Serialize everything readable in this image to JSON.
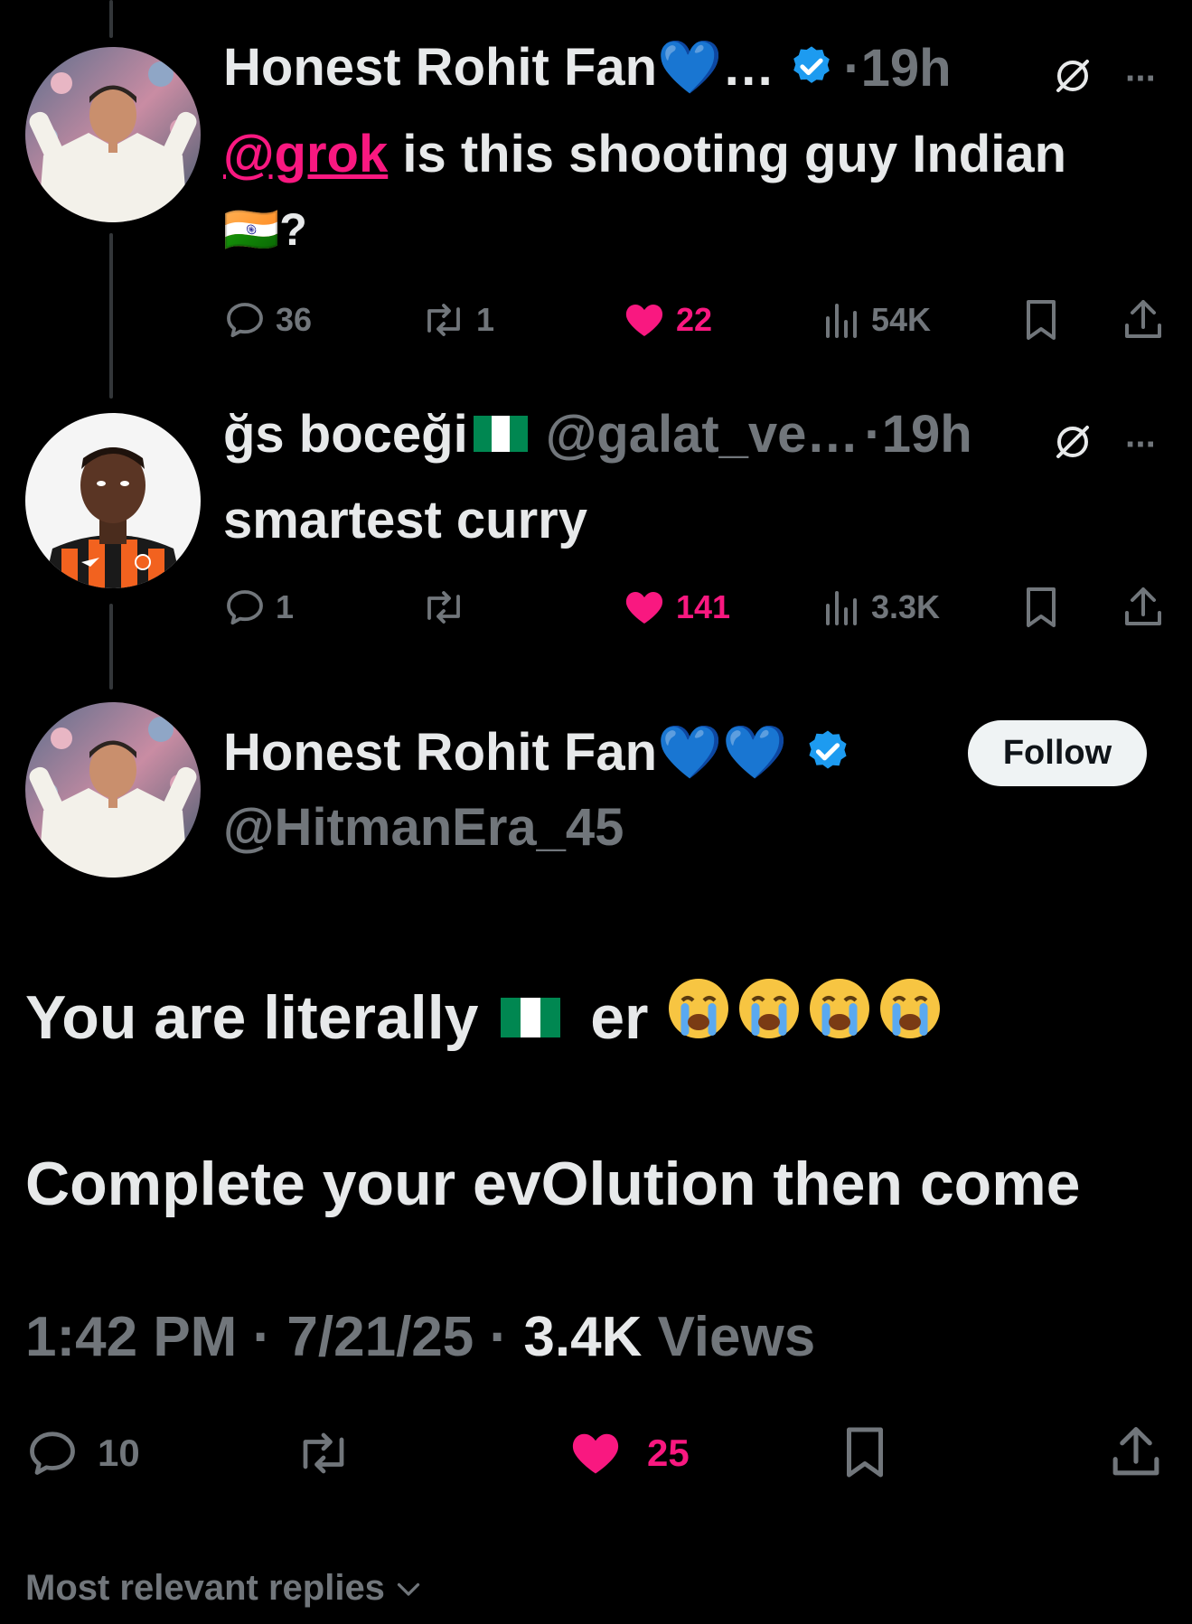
{
  "thread": {
    "tweet1": {
      "display_name": "Honest Rohit Fan💙…",
      "timestamp": "·19h",
      "mention": "@grok",
      "text_main": " is this shooting guy Indian",
      "text_line2": "🇮🇳?",
      "replies": "36",
      "retweets": "1",
      "likes": "22",
      "views": "54K"
    },
    "tweet2": {
      "display_name": "ğs boceği",
      "handle": "@galat_ve…",
      "timestamp": "·19h",
      "text": "smartest curry",
      "replies": "1",
      "retweets": "",
      "likes": "141",
      "views": "3.3K"
    }
  },
  "main_tweet": {
    "display_name": "Honest Rohit Fan💙💙",
    "handle": "@HitmanEra_45",
    "follow_label": "Follow",
    "line1_start": "You are literally ",
    "line1_end": " er",
    "line2": "Complete your evOlution then come",
    "time": "1:42 PM · 7/21/25 · ",
    "views_count": "3.4K",
    "views_label": " Views",
    "replies": "10",
    "likes": "25"
  },
  "footer": {
    "sort_label": "Most relevant replies"
  },
  "colors": {
    "background": "#000000",
    "text": "#e7e9ea",
    "muted": "#71767b",
    "like": "#f91880",
    "mention": "#f91880",
    "verified": "#1d9bf0"
  }
}
